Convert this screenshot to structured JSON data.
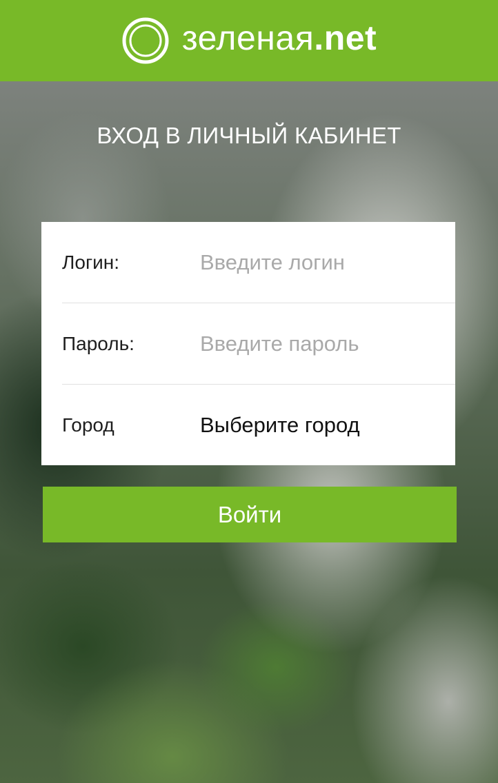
{
  "header": {
    "brand_main": "зеленая",
    "brand_suffix": ".net",
    "logo_icon": "circle-ring-icon",
    "background_color": "#78b928"
  },
  "page": {
    "title": "ВХОД В ЛИЧНЫЙ КАБИНЕТ"
  },
  "form": {
    "login": {
      "label": "Логин:",
      "placeholder": "Введите логин",
      "value": ""
    },
    "password": {
      "label": "Пароль:",
      "placeholder": "Введите пароль",
      "value": ""
    },
    "city": {
      "label": "Город",
      "selected": "Выберите город"
    },
    "submit_label": "Войти"
  },
  "colors": {
    "accent": "#78b928",
    "placeholder": "#a9a9a9",
    "text": "#1e1e1e"
  }
}
